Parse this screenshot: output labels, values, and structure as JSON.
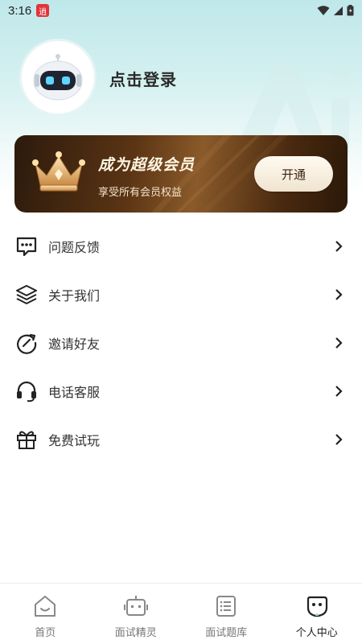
{
  "status_bar": {
    "time": "3:16",
    "app_badge": "逍"
  },
  "profile": {
    "login_text": "点击登录",
    "watermark_text": "Ai"
  },
  "vip": {
    "title": "成为超级会员",
    "subtitle": "享受所有会员权益",
    "button_label": "开通"
  },
  "menu": {
    "items": [
      {
        "label": "问题反馈",
        "icon": "feedback-icon"
      },
      {
        "label": "关于我们",
        "icon": "layers-icon"
      },
      {
        "label": "邀请好友",
        "icon": "refresh-icon"
      },
      {
        "label": "电话客服",
        "icon": "headset-icon"
      },
      {
        "label": "免费试玩",
        "icon": "gift-icon"
      }
    ]
  },
  "bottom_nav": {
    "items": [
      {
        "label": "首页",
        "icon": "home-icon",
        "active": false
      },
      {
        "label": "面试精灵",
        "icon": "robot-icon",
        "active": false
      },
      {
        "label": "面试题库",
        "icon": "list-icon",
        "active": false
      },
      {
        "label": "个人中心",
        "icon": "profile-icon",
        "active": true
      }
    ]
  },
  "colors": {
    "header_top": "#bfe8ea",
    "vip_dark": "#2c1a0c",
    "vip_gold": "#8a5a2a",
    "text_primary": "#333333",
    "nav_inactive": "#777777"
  }
}
